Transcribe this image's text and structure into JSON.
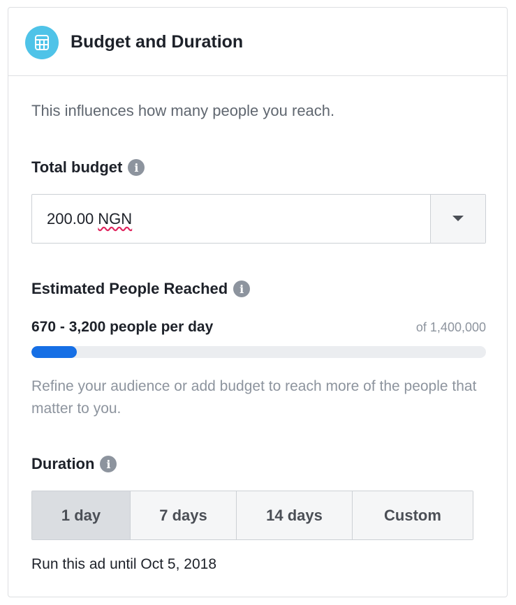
{
  "header": {
    "title": "Budget and Duration",
    "icon": "calculator-icon",
    "icon_color": "#4fc3e8"
  },
  "intro": {
    "text": "This influences how many people you reach."
  },
  "budget": {
    "label": "Total budget",
    "amount": "200.00",
    "currency": "NGN",
    "dropdown_icon": "caret-down-icon"
  },
  "reach": {
    "label": "Estimated People Reached",
    "range": "670 - 3,200 people per day",
    "total": "of 1,400,000",
    "progress_fraction": 0.1,
    "progress_color": "#166fe5",
    "hint": "Refine your audience or add budget to reach more of the people that matter to you."
  },
  "duration": {
    "label": "Duration",
    "options": [
      "1 day",
      "7 days",
      "14 days",
      "Custom"
    ],
    "selected": "1 day",
    "run_until": "Run this ad until Oct 5, 2018"
  }
}
